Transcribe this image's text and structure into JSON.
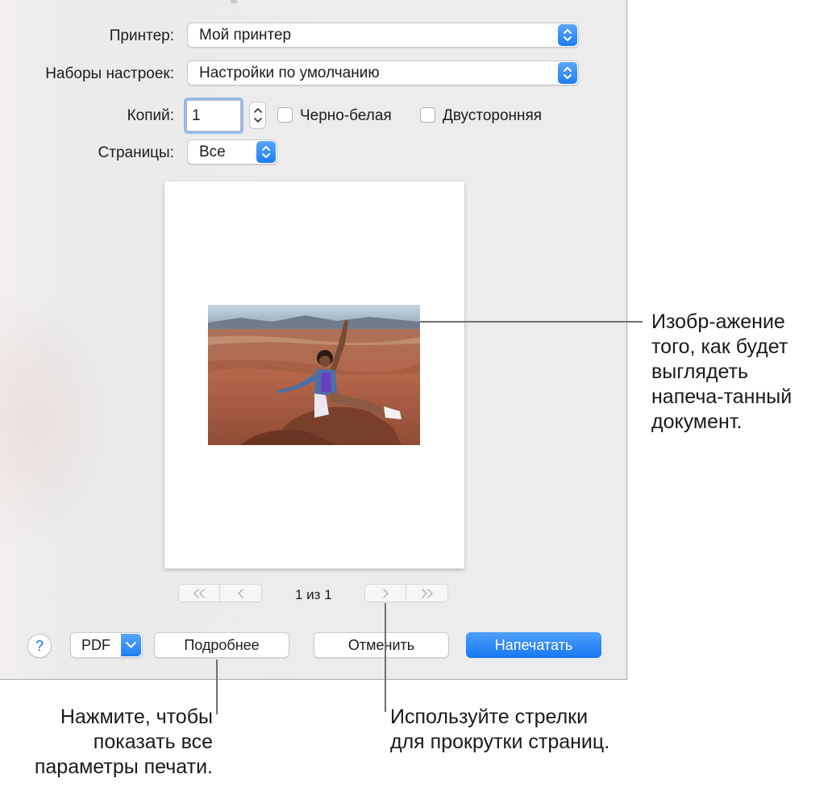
{
  "dialog": {
    "printer": {
      "label": "Принтер:",
      "value": "Мой принтер"
    },
    "presets": {
      "label": "Наборы настроек:",
      "value": "Настройки по умолчанию"
    },
    "copies": {
      "label": "Копий:",
      "value": "1"
    },
    "black_white": {
      "label": "Черно-белая",
      "checked": false
    },
    "two_sided": {
      "label": "Двусторонняя",
      "checked": false
    },
    "pages": {
      "label": "Страницы:",
      "value": "Все"
    },
    "page_navigation": {
      "first_icon": "double-chevron-left-icon",
      "prev_icon": "chevron-left-icon",
      "next_icon": "chevron-right-icon",
      "last_icon": "double-chevron-right-icon",
      "page_count": "1 из 1"
    },
    "help_label": "?",
    "pdf_label": "PDF",
    "details_label": "Подробнее",
    "cancel_label": "Отменить",
    "print_label": "Напечатать",
    "accent_color": "#1f7df2"
  },
  "callouts": {
    "preview": [
      "Изобр-ажение",
      "того, как будет",
      "выглядеть",
      "напеча-танный",
      "документ."
    ],
    "details": [
      "Нажмите, чтобы",
      "показать все",
      "параметры печати."
    ],
    "arrows": [
      "Используйте стрелки",
      "для прокрутки страниц."
    ]
  }
}
